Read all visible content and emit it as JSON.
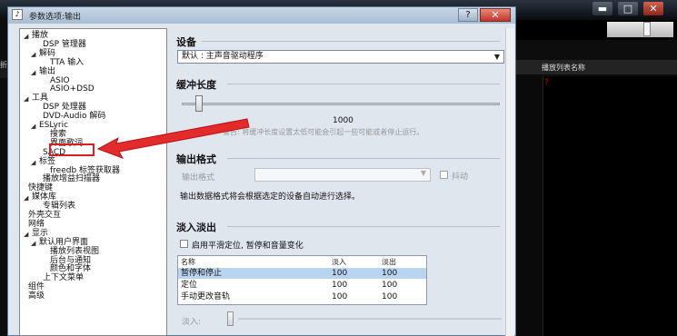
{
  "dialog": {
    "title": "参数选项:输出",
    "help_glyph": "?",
    "close_glyph": "✕"
  },
  "player": {
    "min_glyph": "▬",
    "max_glyph": "□",
    "close_glyph": "✕",
    "left_tab": "折",
    "playlist_header": "播放列表名称",
    "playlist_marker": "?"
  },
  "tree": [
    {
      "label": "播放",
      "indent": 0,
      "toggle": "◢"
    },
    {
      "label": "DSP 管理器",
      "indent": 2,
      "toggle": ""
    },
    {
      "label": "解码",
      "indent": 1,
      "toggle": "◢"
    },
    {
      "label": "TTA 输入",
      "indent": 3,
      "toggle": ""
    },
    {
      "label": "输出",
      "indent": 1,
      "toggle": "◢"
    },
    {
      "label": "ASIO",
      "indent": 3,
      "toggle": ""
    },
    {
      "label": "ASIO+DSD",
      "indent": 3,
      "toggle": ""
    },
    {
      "label": "工具",
      "indent": 0,
      "toggle": "◢"
    },
    {
      "label": "DSP 处理器",
      "indent": 2,
      "toggle": ""
    },
    {
      "label": "DVD-Audio 解码",
      "indent": 2,
      "toggle": ""
    },
    {
      "label": "ESLyric",
      "indent": 1,
      "toggle": "◢"
    },
    {
      "label": "搜索",
      "indent": 3,
      "toggle": ""
    },
    {
      "label": "界面歌词",
      "indent": 3,
      "toggle": ""
    },
    {
      "label": "SACD",
      "indent": 2,
      "toggle": ""
    },
    {
      "label": "标签",
      "indent": 1,
      "toggle": "◢"
    },
    {
      "label": "freedb 标签获取器",
      "indent": 3,
      "toggle": ""
    },
    {
      "label": "播放增益扫描器",
      "indent": 2,
      "toggle": ""
    },
    {
      "label": "快捷键",
      "indent": 0,
      "toggle": ""
    },
    {
      "label": "媒体库",
      "indent": 0,
      "toggle": "◢"
    },
    {
      "label": "专辑列表",
      "indent": 2,
      "toggle": ""
    },
    {
      "label": "外壳交互",
      "indent": 0,
      "toggle": ""
    },
    {
      "label": "网络",
      "indent": 0,
      "toggle": ""
    },
    {
      "label": "显示",
      "indent": 0,
      "toggle": "◢"
    },
    {
      "label": "默认用户界面",
      "indent": 1,
      "toggle": "◢"
    },
    {
      "label": "播放列表视图",
      "indent": 3,
      "toggle": ""
    },
    {
      "label": "后台与通知",
      "indent": 3,
      "toggle": ""
    },
    {
      "label": "颜色和字体",
      "indent": 3,
      "toggle": ""
    },
    {
      "label": "上下文菜单",
      "indent": 2,
      "toggle": ""
    },
    {
      "label": "组件",
      "indent": 0,
      "toggle": ""
    },
    {
      "label": "高级",
      "indent": 0,
      "toggle": ""
    }
  ],
  "device": {
    "heading": "设备",
    "selected": "默认 : 主声音驱动程序"
  },
  "buffer": {
    "heading": "缓冲长度",
    "value": "1000",
    "hint": "警告: 将缓冲长度设置太低可能会引起一些可能或者停止运行。"
  },
  "format": {
    "heading": "输出格式",
    "field_label": "输出格式",
    "dither_label": "抖动",
    "description": "输出数据格式将会根据选定的设备自动进行选择。"
  },
  "fade": {
    "heading": "淡入淡出",
    "smooth_label": "启用平滑定位, 暂停和音量变化",
    "columns": [
      "名称",
      "淡入",
      "淡出"
    ],
    "rows": [
      {
        "name": "暂停和停止",
        "in": "100",
        "out": "100"
      },
      {
        "name": "定位",
        "in": "100",
        "out": "100"
      },
      {
        "name": "手动更改音轨",
        "in": "100",
        "out": "100"
      }
    ],
    "fade_in_label": "淡入:"
  }
}
